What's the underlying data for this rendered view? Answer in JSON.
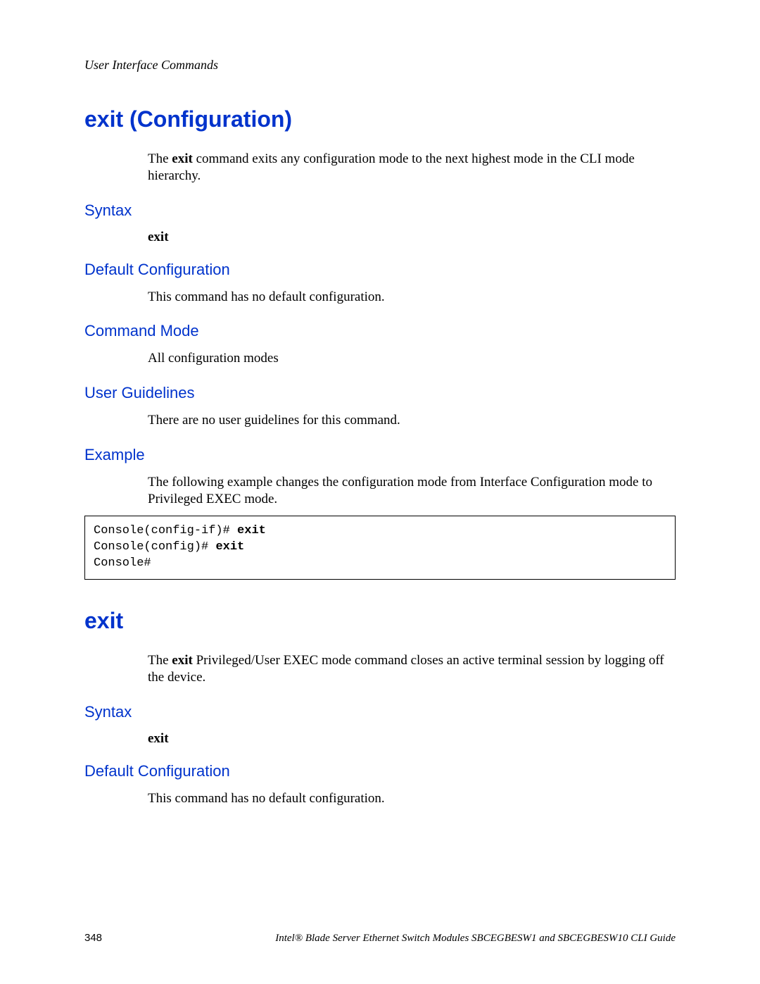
{
  "header": {
    "running_title": "User Interface Commands"
  },
  "section1": {
    "title": "exit (Configuration)",
    "intro_pre": "The ",
    "intro_bold": "exit",
    "intro_post": " command exits any configuration mode to the next highest mode in the CLI mode hierarchy.",
    "syntax_heading": "Syntax",
    "syntax_keyword": "exit",
    "default_heading": "Default Configuration",
    "default_body": "This command has no default configuration.",
    "mode_heading": "Command Mode",
    "mode_body": "All configuration modes",
    "guidelines_heading": "User Guidelines",
    "guidelines_body": "There are no user guidelines for this command.",
    "example_heading": "Example",
    "example_body": "The following example changes the configuration mode from Interface Configuration mode to Privileged EXEC mode.",
    "code_line1_prompt": "Console(config-if)# ",
    "code_line1_cmd": "exit",
    "code_line2_prompt": "Console(config)# ",
    "code_line2_cmd": "exit",
    "code_line3": "Console#"
  },
  "section2": {
    "title": "exit",
    "intro_pre": "The ",
    "intro_bold": "exit",
    "intro_post": " Privileged/User EXEC mode command closes an active terminal session by logging off the device.",
    "syntax_heading": "Syntax",
    "syntax_keyword": "exit",
    "default_heading": "Default Configuration",
    "default_body": "This command has no default configuration."
  },
  "footer": {
    "page_number": "348",
    "guide_title": "Intel® Blade Server Ethernet Switch Modules SBCEGBESW1 and SBCEGBESW10 CLI Guide"
  }
}
